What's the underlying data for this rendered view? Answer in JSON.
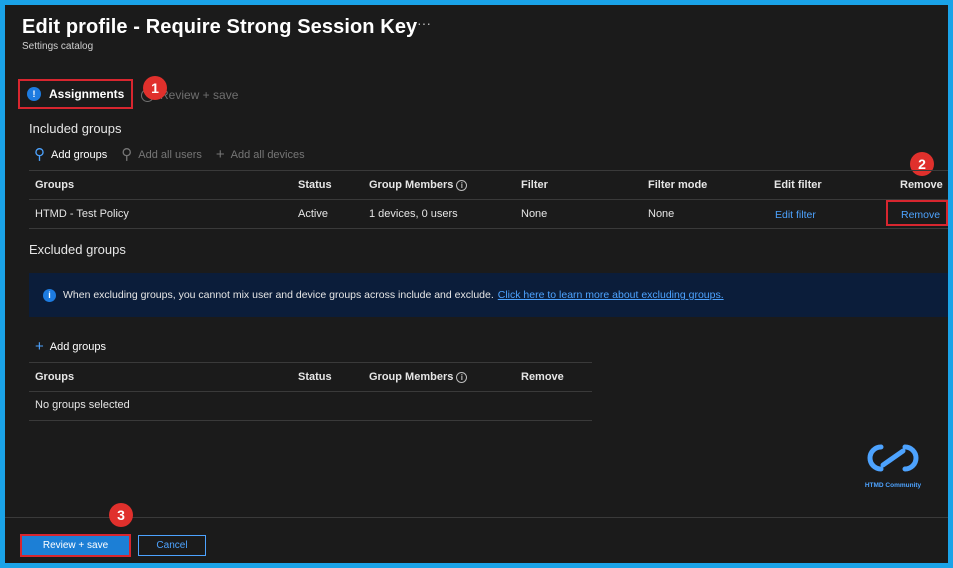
{
  "header": {
    "title": "Edit profile - Require Strong Session Key",
    "subtitle": "Settings catalog",
    "more": "···"
  },
  "tabs": {
    "assignments": "Assignments",
    "review": "Review + save"
  },
  "badges": [
    "1",
    "2",
    "3"
  ],
  "included": {
    "heading": "Included groups",
    "toolbar": {
      "add_groups": "Add groups",
      "add_all_users": "Add all users",
      "add_all_devices": "Add all devices"
    },
    "columns": [
      "Groups",
      "Status",
      "Group Members",
      "Filter",
      "Filter mode",
      "Edit filter",
      "Remove"
    ],
    "rows": [
      {
        "group": "HTMD - Test Policy",
        "status": "Active",
        "members": "1 devices, 0 users",
        "filter": "None",
        "filter_mode": "None",
        "edit_filter": "Edit filter",
        "remove": "Remove"
      }
    ]
  },
  "excluded": {
    "heading": "Excluded groups",
    "banner_text": "When excluding groups, you cannot mix user and device groups across include and exclude.",
    "banner_link": "Click here to learn more about excluding groups.",
    "add_groups": "Add groups",
    "columns": [
      "Groups",
      "Status",
      "Group Members",
      "Remove"
    ],
    "empty": "No groups selected"
  },
  "footer": {
    "primary": "Review + save",
    "cancel": "Cancel"
  },
  "watermark": {
    "text": "HTMD Community"
  },
  "colors": {
    "accent": "#1c7fd6",
    "link": "#4da3ff",
    "highlight": "#d8262f",
    "banner_bg": "#0b1d3a"
  }
}
